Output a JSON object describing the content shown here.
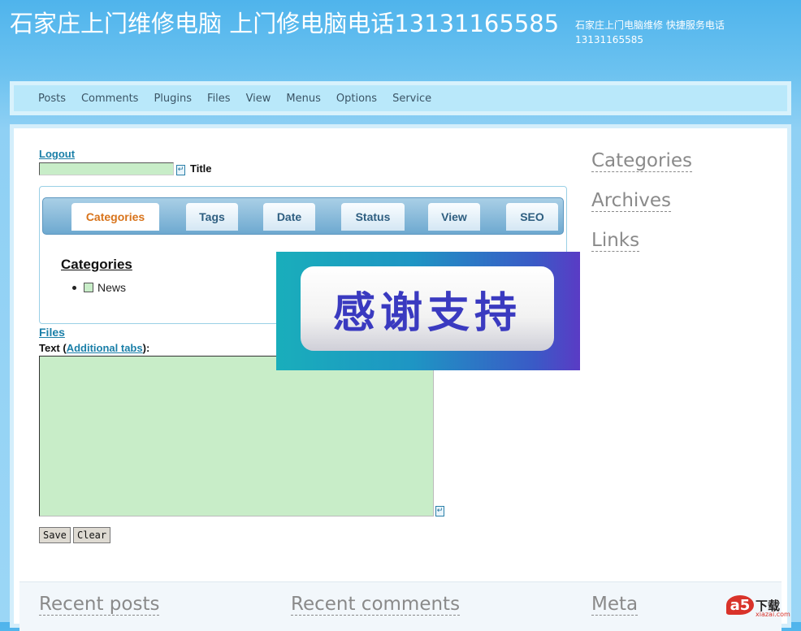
{
  "header": {
    "title": "石家庄上门维修电脑 上门修电脑电话13131165585",
    "description": "石家庄上门电脑维修 快捷服务电话13131165585"
  },
  "nav": {
    "items": [
      "Posts",
      "Comments",
      "Plugins",
      "Files",
      "View",
      "Menus",
      "Options",
      "Service"
    ]
  },
  "form": {
    "logout": "Logout",
    "title_label": "Title",
    "title_value": "",
    "resize_icon": "expand-icon",
    "tabs": [
      "Categories",
      "Tags",
      "Date",
      "Status",
      "View",
      "SEO"
    ],
    "active_tab": "Categories",
    "panel_heading": "Categories",
    "categories": [
      "News"
    ],
    "files_link": "Files",
    "text_label_prefix": "Text (",
    "text_label_link": "Additional tabs",
    "text_label_suffix": "):",
    "text_value": "",
    "save": "Save",
    "clear": "Clear"
  },
  "sidebar": {
    "links": [
      "Categories",
      "Archives",
      "Links"
    ]
  },
  "footer": {
    "headings": [
      "Recent posts",
      "Recent comments",
      "Meta"
    ]
  },
  "overlay": {
    "text": "感谢支持"
  },
  "watermark": {
    "logo": "a5",
    "text": "下载",
    "sub": "xiazai.com"
  },
  "colors": {
    "accent_link": "#1a7fa8",
    "active_tab": "#d8731a",
    "input_bg": "#c8edc8"
  }
}
